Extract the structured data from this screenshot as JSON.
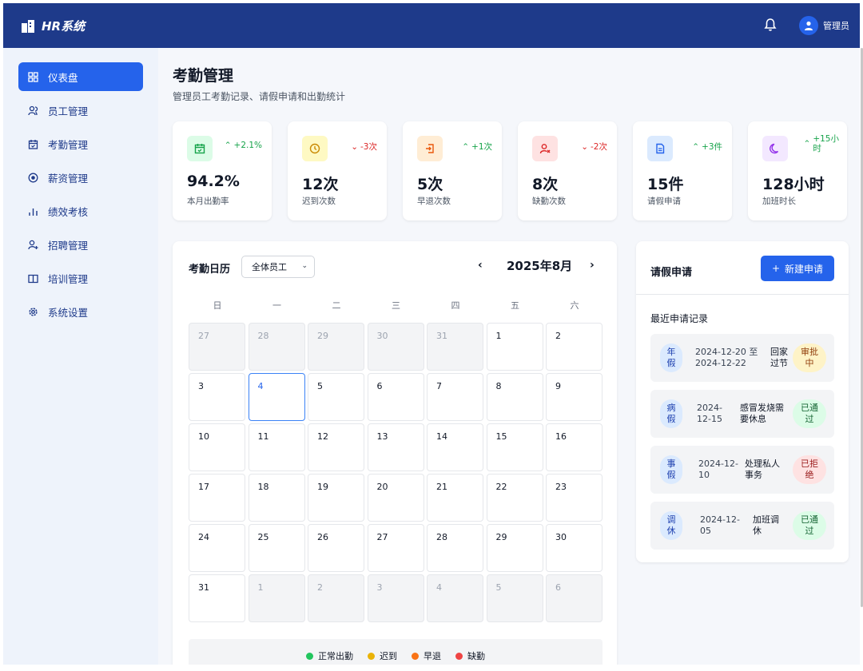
{
  "app": {
    "title": "HR系统",
    "user_name": "管理员"
  },
  "sidebar": {
    "items": [
      {
        "label": "仪表盘",
        "icon": "grid-icon",
        "active": true
      },
      {
        "label": "员工管理",
        "icon": "users-icon",
        "active": false
      },
      {
        "label": "考勤管理",
        "icon": "calendar-icon",
        "active": false
      },
      {
        "label": "薪资管理",
        "icon": "coin-icon",
        "active": false
      },
      {
        "label": "绩效考核",
        "icon": "bar-chart-icon",
        "active": false
      },
      {
        "label": "招聘管理",
        "icon": "user-plus-icon",
        "active": false
      },
      {
        "label": "培训管理",
        "icon": "book-icon",
        "active": false
      },
      {
        "label": "系统设置",
        "icon": "gear-icon",
        "active": false
      }
    ]
  },
  "page": {
    "title": "考勤管理",
    "subtitle": "管理员工考勤记录、请假申请和出勤统计"
  },
  "stats": [
    {
      "value": "94.2%",
      "label": "本月出勤率",
      "change": "+2.1%",
      "direction": "up",
      "icon": "calendar-check-icon",
      "color": "#16a34a",
      "bg": "#dcfce7"
    },
    {
      "value": "12次",
      "label": "迟到次数",
      "change": "-3次",
      "direction": "down",
      "icon": "clock-icon",
      "color": "#ca8a04",
      "bg": "#fef9c3"
    },
    {
      "value": "5次",
      "label": "早退次数",
      "change": "+1次",
      "direction": "up",
      "icon": "exit-icon",
      "color": "#ea580c",
      "bg": "#ffedd5"
    },
    {
      "value": "8次",
      "label": "缺勤次数",
      "change": "-2次",
      "direction": "down",
      "icon": "user-x-icon",
      "color": "#dc2626",
      "bg": "#fee2e2"
    },
    {
      "value": "15件",
      "label": "请假申请",
      "change": "+3件",
      "direction": "up",
      "icon": "document-icon",
      "color": "#2563eb",
      "bg": "#dbeafe"
    },
    {
      "value": "128小时",
      "label": "加班时长",
      "change_line1": "+15小",
      "change_line2": "时",
      "direction": "up",
      "icon": "moon-icon",
      "color": "#9333ea",
      "bg": "#f3e8ff"
    }
  ],
  "calendar": {
    "title": "考勤日历",
    "filter_value": "全体员工",
    "month": "2025年8月",
    "weekdays": [
      "日",
      "一",
      "二",
      "三",
      "四",
      "五",
      "六"
    ],
    "days": [
      {
        "d": "27",
        "other": true
      },
      {
        "d": "28",
        "other": true
      },
      {
        "d": "29",
        "other": true
      },
      {
        "d": "30",
        "other": true
      },
      {
        "d": "31",
        "other": true
      },
      {
        "d": "1"
      },
      {
        "d": "2"
      },
      {
        "d": "3"
      },
      {
        "d": "4",
        "today": true
      },
      {
        "d": "5"
      },
      {
        "d": "6"
      },
      {
        "d": "7"
      },
      {
        "d": "8"
      },
      {
        "d": "9"
      },
      {
        "d": "10"
      },
      {
        "d": "11"
      },
      {
        "d": "12"
      },
      {
        "d": "13"
      },
      {
        "d": "14"
      },
      {
        "d": "15"
      },
      {
        "d": "16"
      },
      {
        "d": "17"
      },
      {
        "d": "18"
      },
      {
        "d": "19"
      },
      {
        "d": "20"
      },
      {
        "d": "21"
      },
      {
        "d": "22"
      },
      {
        "d": "23"
      },
      {
        "d": "24"
      },
      {
        "d": "25"
      },
      {
        "d": "26"
      },
      {
        "d": "27"
      },
      {
        "d": "28"
      },
      {
        "d": "29"
      },
      {
        "d": "30"
      },
      {
        "d": "31"
      },
      {
        "d": "1",
        "other": true
      },
      {
        "d": "2",
        "other": true
      },
      {
        "d": "3",
        "other": true
      },
      {
        "d": "4",
        "other": true
      },
      {
        "d": "5",
        "other": true
      },
      {
        "d": "6",
        "other": true
      }
    ],
    "legend": [
      {
        "label": "正常出勤",
        "color": "#22c55e"
      },
      {
        "label": "迟到",
        "color": "#eab308"
      },
      {
        "label": "早退",
        "color": "#f97316"
      },
      {
        "label": "缺勤",
        "color": "#ef4444"
      }
    ]
  },
  "leave": {
    "title": "请假申请",
    "new_button": "新建申请",
    "recent_title": "最近申请记录",
    "items": [
      {
        "type1": "年",
        "type2": "假",
        "date1": "2024-12-20 至",
        "date2": "2024-12-22",
        "reason1": "回家",
        "reason2": "过节",
        "status1": "审批",
        "status2": "中",
        "status": "pending"
      },
      {
        "type1": "病",
        "type2": "假",
        "date1": "2024-",
        "date2": "12-15",
        "reason1": "感冒发烧需",
        "reason2": "要休息",
        "status1": "已通",
        "status2": "过",
        "status": "approved"
      },
      {
        "type1": "事",
        "type2": "假",
        "date1": "2024-12-",
        "date2": "10",
        "reason1": "处理私人",
        "reason2": "事务",
        "status1": "已拒",
        "status2": "绝",
        "status": "rejected"
      },
      {
        "type1": "调",
        "type2": "休",
        "date1": "2024-12-",
        "date2": "05",
        "reason1": "加班调",
        "reason2": "休",
        "status1": "已通",
        "status2": "过",
        "status": "approved"
      }
    ]
  }
}
